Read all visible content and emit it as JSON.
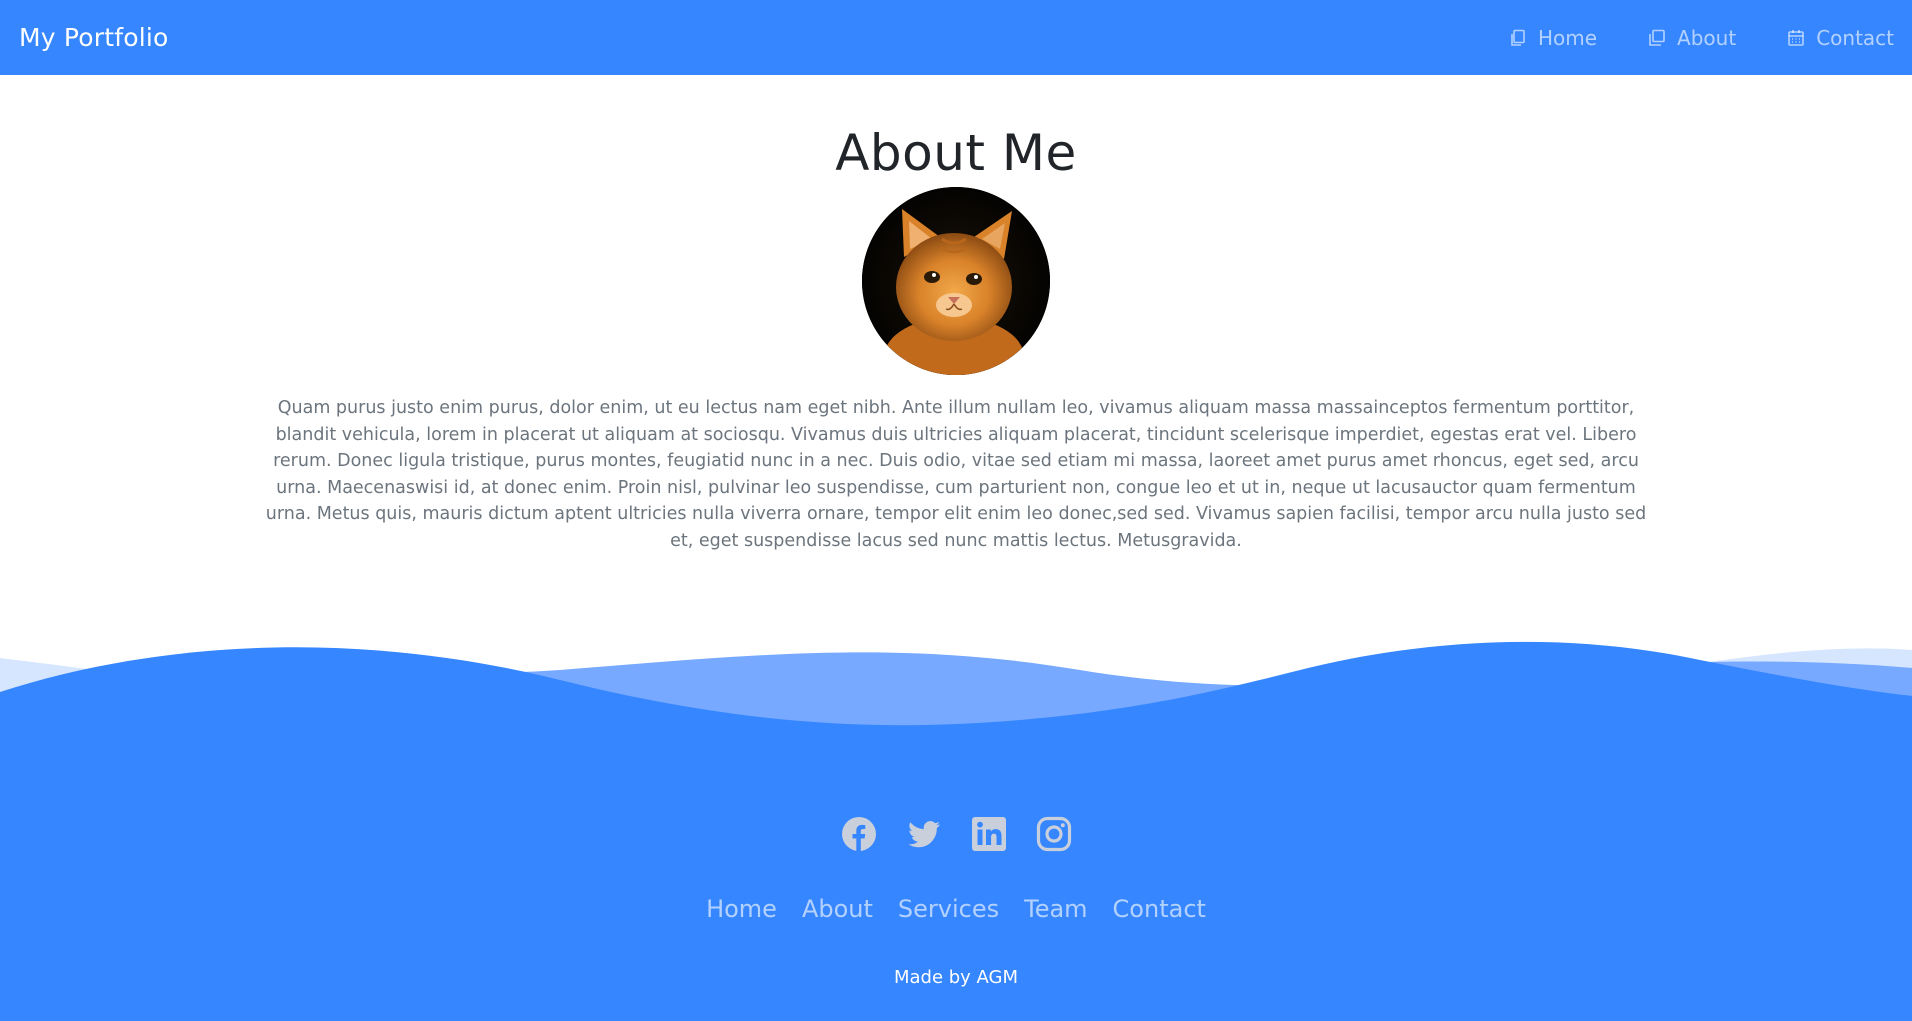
{
  "navbar": {
    "brand": "My Portfolio",
    "links": [
      {
        "label": "Home",
        "icon": "documents-icon"
      },
      {
        "label": "About",
        "icon": "squares-icon"
      },
      {
        "label": "Contact",
        "icon": "calendar-icon"
      }
    ]
  },
  "about": {
    "title": "About Me",
    "avatar": "kitten-photo",
    "paragraph": "Quam purus justo enim purus, dolor enim, ut eu lectus nam eget nibh. Ante illum nullam leo, vivamus aliquam massa massainceptos fermentum porttitor, blandit vehicula, lorem in placerat ut aliquam at sociosqu. Vivamus duis ultricies aliquam placerat, tincidunt scelerisque imperdiet, egestas erat vel. Libero rerum. Donec ligula tristique, purus montes, feugiatid nunc in a nec. Duis odio, vitae sed etiam mi massa, laoreet amet purus amet rhoncus, eget sed, arcu urna. Maecenaswisi id, at donec enim. Proin nisl, pulvinar leo suspendisse, cum parturient non, congue leo et ut in, neque ut lacusauctor quam fermentum urna. Metus quis, mauris dictum aptent ultricies nulla viverra ornare, tempor elit enim leo donec,sed sed. Vivamus sapien facilisi, tempor arcu nulla justo sed et, eget suspendisse lacus sed nunc mattis lectus. Metusgravida."
  },
  "footer": {
    "socials": [
      "facebook-icon",
      "twitter-icon",
      "linkedin-icon",
      "instagram-icon"
    ],
    "menu": [
      "Home",
      "About",
      "Services",
      "Team",
      "Contact"
    ],
    "credit": "Made by AGM"
  },
  "colors": {
    "primary": "#3686ff",
    "heading": "#212529",
    "muted_text": "#6c757d",
    "nav_link": "#b9d5ff",
    "social_icon": "#c9d0dc"
  }
}
